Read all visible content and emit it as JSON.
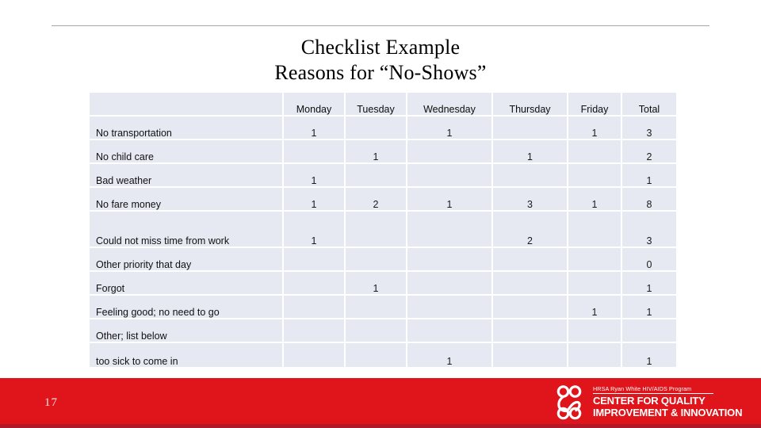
{
  "slide": {
    "title_line1": "Checklist Example",
    "title_line2": "Reasons for “No-Shows”",
    "page_number": "17",
    "accent_red": "#e0141b",
    "table_cell_bg": "#e6e9f2",
    "rule_color": "#a6a6a6"
  },
  "table": {
    "columns": [
      "",
      "Monday",
      "Tuesday",
      "Wednesday",
      "Thursday",
      "Friday",
      "Total"
    ],
    "rows": [
      {
        "label": "No transportation",
        "monday": "1",
        "tuesday": "",
        "wednesday": "1",
        "thursday": "",
        "friday": "1",
        "total": "3"
      },
      {
        "label": "No child care",
        "monday": "",
        "tuesday": "1",
        "wednesday": "",
        "thursday": "1",
        "friday": "",
        "total": "2"
      },
      {
        "label": "Bad weather",
        "monday": "1",
        "tuesday": "",
        "wednesday": "",
        "thursday": "",
        "friday": "",
        "total": "1"
      },
      {
        "label": "No fare money",
        "monday": "1",
        "tuesday": "2",
        "wednesday": "1",
        "thursday": "3",
        "friday": "1",
        "total": "8"
      },
      {
        "label": "Could not miss time from work",
        "monday": "1",
        "tuesday": "",
        "wednesday": "",
        "thursday": "2",
        "friday": "",
        "total": "3"
      },
      {
        "label": "Other priority that day",
        "monday": "",
        "tuesday": "",
        "wednesday": "",
        "thursday": "",
        "friday": "",
        "total": "0"
      },
      {
        "label": "Forgot",
        "monday": "",
        "tuesday": "1",
        "wednesday": "",
        "thursday": "",
        "friday": "",
        "total": "1"
      },
      {
        "label": "Feeling good; no need to go",
        "monday": "",
        "tuesday": "",
        "wednesday": "",
        "thursday": "",
        "friday": "1",
        "total": "1"
      },
      {
        "label": "Other; list below",
        "monday": "",
        "tuesday": "",
        "wednesday": "",
        "thursday": "",
        "friday": "",
        "total": ""
      },
      {
        "label": "too sick to come in",
        "monday": "",
        "tuesday": "",
        "wednesday": "1",
        "thursday": "",
        "friday": "",
        "total": "1"
      }
    ]
  },
  "footer": {
    "logo_tagline": "HRSA Ryan White HIV/AIDS Program",
    "logo_line1": "CENTER FOR QUALITY",
    "logo_line2": "IMPROVEMENT & INNOVATION",
    "logo_mark_name": "two-people-intertwined-logo"
  }
}
